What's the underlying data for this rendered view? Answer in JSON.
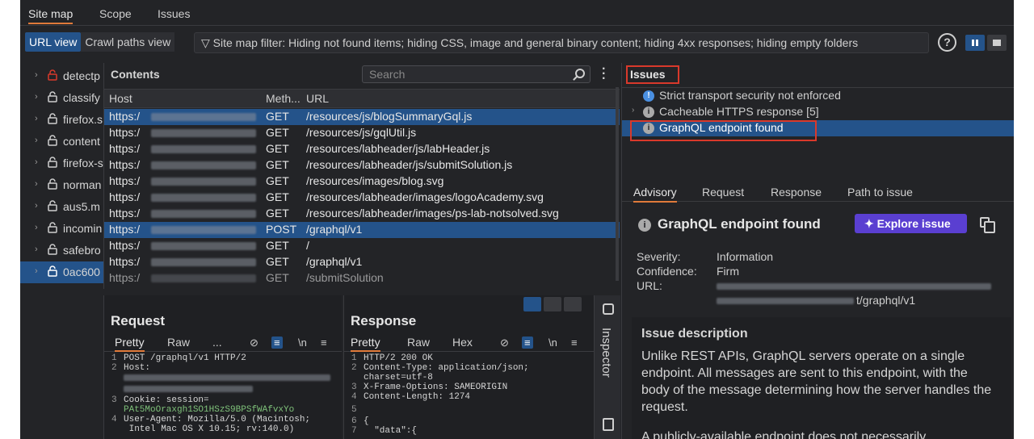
{
  "top_tabs": [
    "Site map",
    "Scope",
    "Issues"
  ],
  "view_toggle": {
    "url_view": "URL view",
    "crawl_paths_view": "Crawl paths view"
  },
  "filter_text": "Site map filter: Hiding not found items; hiding CSS, image and general binary content; hiding 4xx responses; hiding empty folders",
  "help_label": "?",
  "tree": [
    {
      "label": "detectp"
    },
    {
      "label": "classify"
    },
    {
      "label": "firefox.s"
    },
    {
      "label": "content"
    },
    {
      "label": "firefox-s"
    },
    {
      "label": "norman"
    },
    {
      "label": "aus5.m"
    },
    {
      "label": "incomin"
    },
    {
      "label": "safebro"
    },
    {
      "label": "0ac600"
    }
  ],
  "contents": {
    "title": "Contents",
    "search_placeholder": "Search",
    "columns": {
      "host": "Host",
      "method": "Meth...",
      "url": "URL"
    },
    "rows": [
      {
        "host": "https:/",
        "method": "GET",
        "url": "/resources/js/blogSummaryGql.js"
      },
      {
        "host": "https:/",
        "method": "GET",
        "url": "/resources/js/gqlUtil.js"
      },
      {
        "host": "https:/",
        "method": "GET",
        "url": "/resources/labheader/js/labHeader.js"
      },
      {
        "host": "https:/",
        "method": "GET",
        "url": "/resources/labheader/js/submitSolution.js"
      },
      {
        "host": "https:/",
        "method": "GET",
        "url": "/resources/images/blog.svg"
      },
      {
        "host": "https:/",
        "method": "GET",
        "url": "/resources/labheader/images/logoAcademy.svg"
      },
      {
        "host": "https:/",
        "method": "GET",
        "url": "/resources/labheader/images/ps-lab-notsolved.svg"
      },
      {
        "host": "https:/",
        "method": "POST",
        "url": "/graphql/v1"
      },
      {
        "host": "https:/",
        "method": "GET",
        "url": "/"
      },
      {
        "host": "https:/",
        "method": "GET",
        "url": "/graphql/v1"
      },
      {
        "host": "https:/",
        "method": "GET",
        "url": "/submitSolution"
      }
    ]
  },
  "request": {
    "title": "Request",
    "tabs": [
      "Pretty",
      "Raw",
      "..."
    ],
    "newline_label": "\\n",
    "lines": [
      {
        "n": "1",
        "t": "POST /graphql/v1 HTTP/2"
      },
      {
        "n": "2",
        "t": "Host:"
      },
      {
        "n": "",
        "t": ""
      },
      {
        "n": "",
        "t": ""
      },
      {
        "n": "3",
        "t": "Cookie: session="
      },
      {
        "n": "",
        "t": "PAt5MoOraxgh1SO1HSzS9BPSfWAfvxYo"
      },
      {
        "n": "4",
        "t": "User-Agent: Mozilla/5.0 (Macintosh;"
      },
      {
        "n": "",
        "t": " Intel Mac OS X 10.15; rv:140.0)"
      }
    ]
  },
  "response": {
    "title": "Response",
    "tabs": [
      "Pretty",
      "Raw",
      "Hex"
    ],
    "newline_label": "\\n",
    "lines": [
      {
        "n": "1",
        "t": "HTTP/2 200 OK"
      },
      {
        "n": "2",
        "t": "Content-Type: application/json;"
      },
      {
        "n": "",
        "t": "charset=utf-8"
      },
      {
        "n": "3",
        "t": "X-Frame-Options: SAMEORIGIN"
      },
      {
        "n": "4",
        "t": "Content-Length: 1274"
      },
      {
        "n": "5",
        "t": ""
      },
      {
        "n": "6",
        "t": "{"
      },
      {
        "n": "7",
        "t": "  \"data\":{"
      }
    ]
  },
  "inspector_label": "Inspector",
  "issues": {
    "title": "Issues",
    "items": [
      {
        "label": "Strict transport security not enforced",
        "severity": "info-blue"
      },
      {
        "label": "Cacheable HTTPS response [5]",
        "severity": "info-grey"
      },
      {
        "label": "GraphQL endpoint found",
        "severity": "info-grey"
      }
    ]
  },
  "detail": {
    "tabs": [
      "Advisory",
      "Request",
      "Response",
      "Path to issue"
    ],
    "heading": "GraphQL endpoint found",
    "explore_label": "Explore issue",
    "severity_label": "Severity:",
    "severity_value": "Information",
    "confidence_label": "Confidence:",
    "confidence_value": "Firm",
    "url_label": "URL:",
    "url_value": "t/graphql/v1",
    "description_title": "Issue description",
    "description_text": "Unlike REST APIs, GraphQL servers operate on a single endpoint. All messages are sent to this endpoint, with the body of the message determining how the server handles the request.",
    "description_more": "A publicly-available endpoint does not necessarily"
  },
  "colors": {
    "accent": "#e07a3a",
    "selection": "#24538a",
    "explore": "#5a3fd1",
    "highlight_outline": "#d9392b"
  }
}
